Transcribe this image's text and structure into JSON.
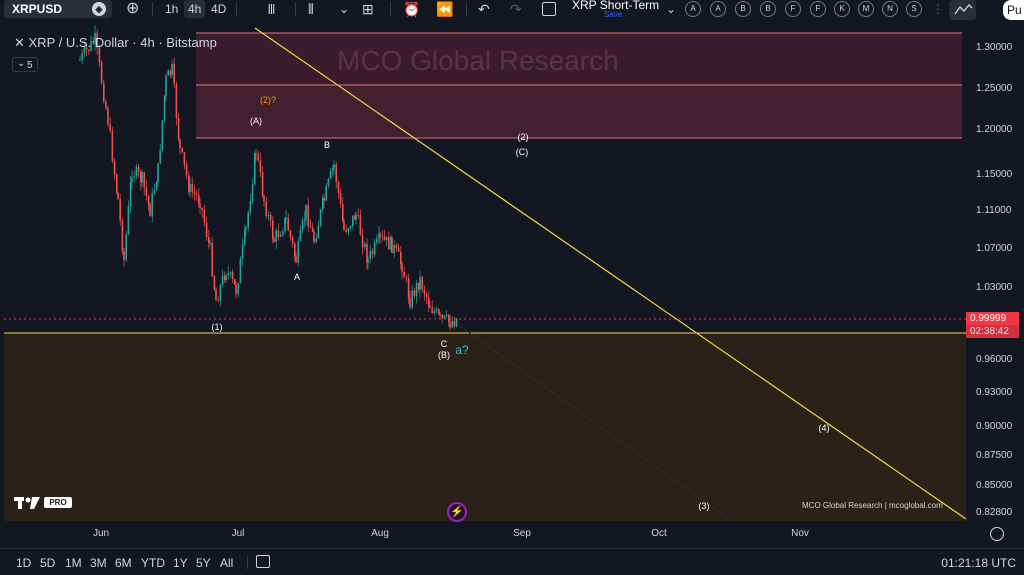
{
  "toolbar": {
    "symbol": "XRPUSD",
    "timeframes": [
      "1h",
      "4h",
      "4D"
    ],
    "active_timeframe": "4h",
    "layout_name": "XRP Short-Term",
    "layout_save": "Save",
    "alert_letters": [
      "A",
      "A",
      "B",
      "B",
      "F",
      "F",
      "K",
      "M",
      "N",
      "S"
    ],
    "publish_label": "Pu"
  },
  "legend": {
    "title": "XRP / U.S. Dollar · 4h · Bitstamp",
    "indicator_count": "5"
  },
  "watermark": "MCO Global Research",
  "price_axis": {
    "ticks": [
      "1.30000",
      "1.25000",
      "1.20000",
      "1.15000",
      "1.11000",
      "1.07000",
      "1.03000",
      "0.96000",
      "0.93000",
      "0.90000",
      "0.87500",
      "0.85000",
      "0.82800"
    ],
    "current_price": "0.99999",
    "countdown": "02:38:42"
  },
  "time_axis": {
    "ticks": [
      "Jun",
      "Jul",
      "Aug",
      "Sep",
      "Oct",
      "Nov"
    ]
  },
  "wave_labels": [
    "(2)?",
    "(A)",
    "B",
    "(2)",
    "(C)",
    "A",
    "(1)",
    "C",
    "(B)",
    "a?",
    "(4)",
    "(3)"
  ],
  "credit": "MCO Global Research | mcoglobal.com",
  "logo": {
    "pro": "PRO"
  },
  "bottom": {
    "ranges": [
      "1D",
      "5D",
      "1M",
      "3M",
      "6M",
      "YTD",
      "1Y",
      "5Y",
      "All"
    ],
    "clock": "01:21:18 UTC"
  },
  "colors": {
    "background": "#131722",
    "resistance_zone": "#3a1c2c",
    "support_zone": "#2a2218",
    "trendline": "#f5d742",
    "bull": "#26a69a",
    "bear": "#ef5350",
    "price_badge": "#f23645"
  }
}
